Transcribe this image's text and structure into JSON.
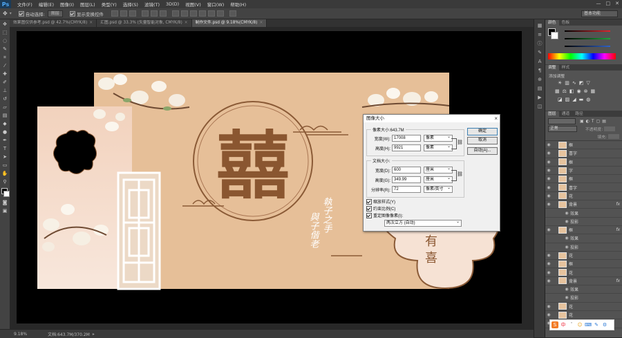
{
  "app": {
    "logo": "Ps"
  },
  "menu": [
    "文件(F)",
    "编辑(E)",
    "图像(I)",
    "图层(L)",
    "类型(Y)",
    "选择(S)",
    "滤镜(T)",
    "3D(D)",
    "视图(V)",
    "窗口(W)",
    "帮助(H)"
  ],
  "window_controls": [
    "—",
    "□",
    "✕"
  ],
  "options_bar": {
    "auto_select_label": "自动选择:",
    "auto_select_value": "图层",
    "show_transform_label": "显示变换控件",
    "workspace": "基本功能"
  },
  "tabs": [
    {
      "label": "效果图仅供参考.psd @ 42.7%(CMYK/8)",
      "active": false
    },
    {
      "label": "汇图.psd @ 33.3% (矢量智能对象, CMYK/8)",
      "active": false
    },
    {
      "label": "制作文件.psd @ 9.18%(CMYK/8)",
      "active": true
    }
  ],
  "status": {
    "zoom": "9.18%",
    "doc_info": "文档:643.7M/370.2M"
  },
  "artwork": {
    "xi": "囍",
    "poem_col1": "執子之手",
    "poem_col2": "與子偕老",
    "card_top": "有",
    "card_bottom": "喜"
  },
  "panels": {
    "color_tabs": [
      "颜色",
      "色板"
    ],
    "adjust_tabs": [
      "调整",
      "样式"
    ],
    "adjust_title": "添加调整",
    "layer_tabs": [
      "图层",
      "通道",
      "路径"
    ],
    "blend_mode": "正常",
    "opacity_label": "不透明度:",
    "fill_label": "填充:",
    "colors": {
      "r": "#e0262d",
      "g": "#1aa83a",
      "b": "#2f63c8"
    }
  },
  "layers": [
    {
      "name": "框",
      "fx": false
    },
    {
      "name": "喜字",
      "fx": false
    },
    {
      "name": "框",
      "fx": false
    },
    {
      "name": "字",
      "fx": false
    },
    {
      "name": "框",
      "fx": false
    },
    {
      "name": "喜字",
      "fx": false
    },
    {
      "name": "花",
      "fx": false
    },
    {
      "name": "背景",
      "fx": true
    },
    {
      "name": "效果",
      "sub": true,
      "fx": false
    },
    {
      "name": "投影",
      "sub": true,
      "fx": false
    },
    {
      "name": "框",
      "fx": true
    },
    {
      "name": "效果",
      "sub": true,
      "fx": false
    },
    {
      "name": "投影",
      "sub": true,
      "fx": false
    },
    {
      "name": "花",
      "fx": false
    },
    {
      "name": "框",
      "fx": false
    },
    {
      "name": "花",
      "fx": false
    },
    {
      "name": "背景",
      "fx": true
    },
    {
      "name": "效果",
      "sub": true,
      "fx": false
    },
    {
      "name": "投影",
      "sub": true,
      "fx": false
    },
    {
      "name": "花",
      "fx": false
    },
    {
      "name": "花",
      "fx": false
    },
    {
      "name": "背景",
      "fx": false
    }
  ],
  "dialog": {
    "title": "图像大小",
    "pixel_dims": "像素大小:643.7M",
    "width_label": "宽度(W):",
    "width_px": "17008",
    "width_px_unit": "像素",
    "height_label": "高度(H):",
    "height_px": "9921",
    "height_px_unit": "像素",
    "doc_size": "文档大小:",
    "doc_width_label": "宽度(D):",
    "doc_width": "600",
    "doc_width_unit": "厘米",
    "doc_height_label": "高度(G):",
    "doc_height": "349.99",
    "doc_height_unit": "厘米",
    "res_label": "分辨率(R):",
    "res": "72",
    "res_unit": "像素/英寸",
    "ok": "确定",
    "cancel": "取消",
    "auto": "自动(A)...",
    "scale_styles": "缩放样式(Y)",
    "constrain": "约束比例(C)",
    "resample": "重定图像像素(I):",
    "resample_method": "两次立方 (自动)"
  },
  "ime": [
    "中",
    "ˇ",
    "☺",
    "⌨",
    "✎",
    "⚙"
  ]
}
